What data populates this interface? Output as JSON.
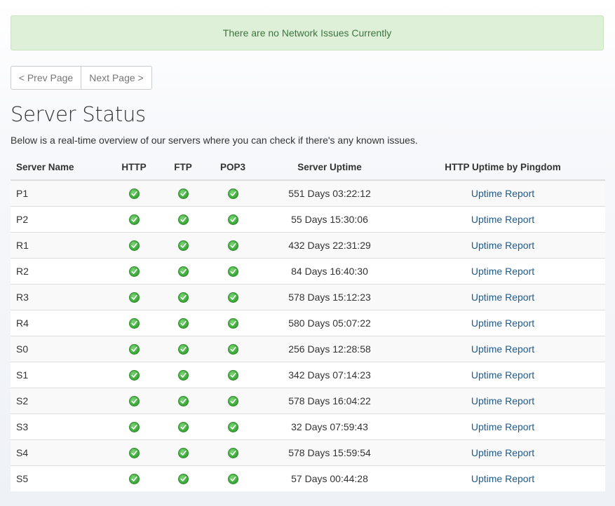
{
  "alert": {
    "text": "There are no Network Issues Currently"
  },
  "pager": {
    "prev_label": "< Prev Page",
    "next_label": "Next Page >"
  },
  "page": {
    "title": "Server Status",
    "intro": "Below is a real-time overview of our servers where you can check if there's any known issues."
  },
  "table": {
    "headers": {
      "name": "Server Name",
      "http": "HTTP",
      "ftp": "FTP",
      "pop3": "POP3",
      "uptime": "Server Uptime",
      "pingdom": "HTTP Uptime by Pingdom"
    },
    "status_icon": "green-check-icon",
    "rows": [
      {
        "name": "P1",
        "uptime": "551 Days 03:22:12",
        "report": "Uptime Report"
      },
      {
        "name": "P2",
        "uptime": "55 Days 15:30:06",
        "report": "Uptime Report"
      },
      {
        "name": "R1",
        "uptime": "432 Days 22:31:29",
        "report": "Uptime Report"
      },
      {
        "name": "R2",
        "uptime": "84 Days 16:40:30",
        "report": "Uptime Report"
      },
      {
        "name": "R3",
        "uptime": "578 Days 15:12:23",
        "report": "Uptime Report"
      },
      {
        "name": "R4",
        "uptime": "580 Days 05:07:22",
        "report": "Uptime Report"
      },
      {
        "name": "S0",
        "uptime": "256 Days 12:28:58",
        "report": "Uptime Report"
      },
      {
        "name": "S1",
        "uptime": "342 Days 07:14:23",
        "report": "Uptime Report"
      },
      {
        "name": "S2",
        "uptime": "578 Days 16:04:22",
        "report": "Uptime Report"
      },
      {
        "name": "S3",
        "uptime": "32 Days 07:59:43",
        "report": "Uptime Report"
      },
      {
        "name": "S4",
        "uptime": "578 Days 15:59:54",
        "report": "Uptime Report"
      },
      {
        "name": "S5",
        "uptime": "57 Days 00:44:28",
        "report": "Uptime Report"
      }
    ]
  },
  "colors": {
    "alert_bg": "#dff0d8",
    "alert_text": "#3c763d",
    "link": "#1f5a8c",
    "status_ok": "#3fae3b"
  }
}
